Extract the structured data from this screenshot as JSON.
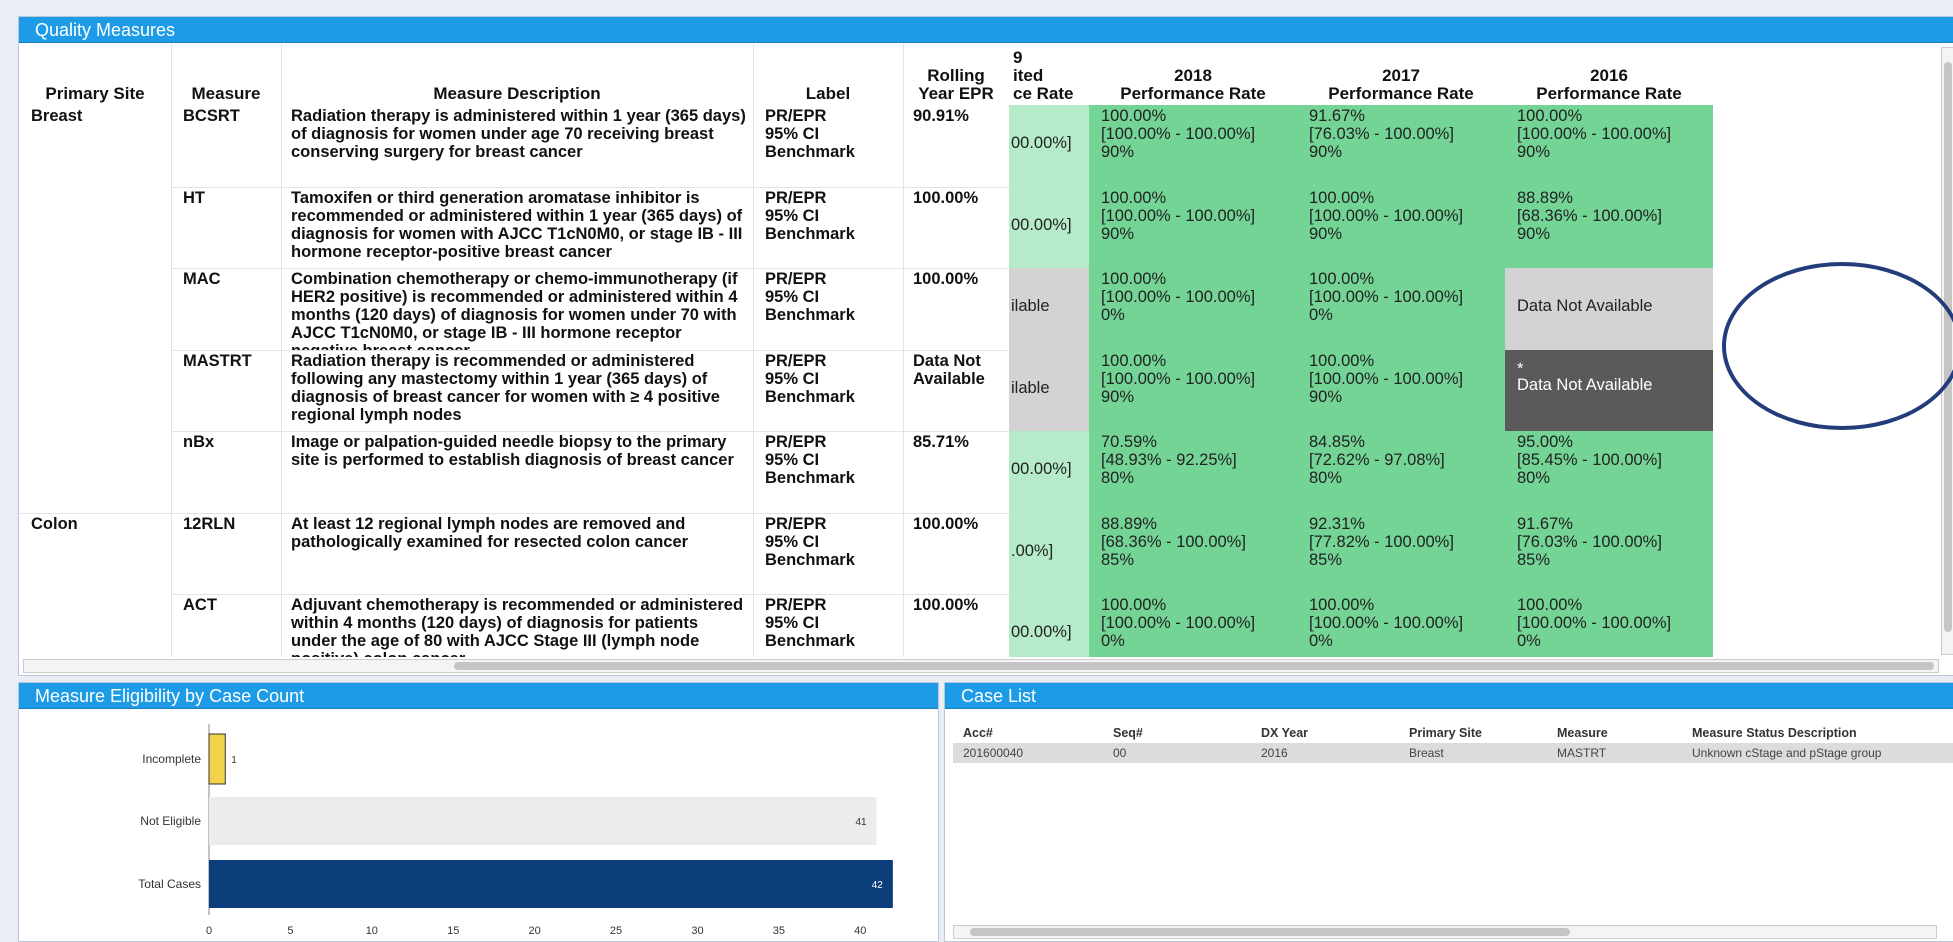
{
  "quality_measures": {
    "title": "Quality Measures",
    "headers": {
      "primary_site": "Primary Site",
      "measure": "Measure",
      "description": "Measure Description",
      "label": "Label",
      "rolling_l1": "Rolling",
      "rolling_l2": "Year EPR",
      "cut_l0": "9",
      "cut_l1": "ited",
      "cut_l2": "ce Rate",
      "y2018_l1": "2018",
      "y2018_l2": "Performance Rate",
      "y2017_l1": "2017",
      "y2017_l2": "Performance Rate",
      "y2016_l1": "2016",
      "y2016_l2": "Performance Rate"
    },
    "rows": [
      {
        "site": "Breast",
        "measure": "BCSRT",
        "desc": "Radiation therapy is administered within 1 year (365 days) of diagnosis for women under age 70 receiving breast conserving surgery for breast cancer",
        "label1": "PR/EPR",
        "label2": "95% CI",
        "label3": "Benchmark",
        "rolling": "90.91%",
        "cut": "00.00%]",
        "y2018": [
          "100.00%",
          "[100.00% - 100.00%]",
          "90%"
        ],
        "y2017": [
          "91.67%",
          "[76.03% - 100.00%]",
          "90%"
        ],
        "y2016": [
          "100.00%",
          "[100.00% - 100.00%]",
          "90%"
        ]
      },
      {
        "site": "",
        "measure": "HT",
        "desc": "Tamoxifen or third generation aromatase inhibitor is recommended or administered within 1 year (365 days) of diagnosis for women with AJCC T1cN0M0, or stage IB - III hormone receptor-positive breast cancer",
        "label1": "PR/EPR",
        "label2": "95% CI",
        "label3": "Benchmark",
        "rolling": "100.00%",
        "cut": "00.00%]",
        "y2018": [
          "100.00%",
          "[100.00% - 100.00%]",
          "90%"
        ],
        "y2017": [
          "100.00%",
          "[100.00% - 100.00%]",
          "90%"
        ],
        "y2016": [
          "88.89%",
          "[68.36% - 100.00%]",
          "90%"
        ]
      },
      {
        "site": "",
        "measure": "MAC",
        "desc": "Combination chemotherapy or chemo-immunotherapy (if HER2 positive) is recommended or administered within 4 months (120 days) of diagnosis for women under 70 with AJCC T1cN0M0, or stage IB - III hormone receptor negative breast cancer",
        "label1": "PR/EPR",
        "label2": "95% CI",
        "label3": "Benchmark",
        "rolling": "100.00%",
        "cut": "ilable",
        "y2018": [
          "100.00%",
          "[100.00% - 100.00%]",
          "0%"
        ],
        "y2017": [
          "100.00%",
          "[100.00% - 100.00%]",
          "0%"
        ],
        "y2016_na": "Data Not Available"
      },
      {
        "site": "",
        "measure": "MASTRT",
        "desc": "Radiation therapy is recommended or administered following any mastectomy within 1 year (365 days) of diagnosis of breast cancer for women with ≥ 4 positive regional lymph nodes",
        "label1": "PR/EPR",
        "label2": "95% CI",
        "label3": "Benchmark",
        "rolling": "Data Not Available",
        "cut": "ilable",
        "y2018": [
          "100.00%",
          "[100.00% - 100.00%]",
          "90%"
        ],
        "y2017": [
          "100.00%",
          "[100.00% - 100.00%]",
          "90%"
        ],
        "y2016_star": "*",
        "y2016_na": "Data Not Available"
      },
      {
        "site": "",
        "measure": "nBx",
        "desc": "Image or palpation-guided needle biopsy to the primary site is performed to establish diagnosis of breast cancer",
        "label1": "PR/EPR",
        "label2": "95% CI",
        "label3": "Benchmark",
        "rolling": "85.71%",
        "cut": "00.00%]",
        "y2018": [
          "70.59%",
          "[48.93% - 92.25%]",
          "80%"
        ],
        "y2017": [
          "84.85%",
          "[72.62% - 97.08%]",
          "80%"
        ],
        "y2016": [
          "95.00%",
          "[85.45% - 100.00%]",
          "80%"
        ]
      },
      {
        "site": "Colon",
        "measure": "12RLN",
        "desc": "At least 12 regional lymph nodes are removed and pathologically examined for resected colon cancer",
        "label1": "PR/EPR",
        "label2": "95% CI",
        "label3": "Benchmark",
        "rolling": "100.00%",
        "cut": ".00%]",
        "y2018": [
          "88.89%",
          "[68.36% - 100.00%]",
          "85%"
        ],
        "y2017": [
          "92.31%",
          "[77.82% - 100.00%]",
          "85%"
        ],
        "y2016": [
          "91.67%",
          "[76.03% - 100.00%]",
          "85%"
        ]
      },
      {
        "site": "",
        "measure": "ACT",
        "desc": "Adjuvant chemotherapy is recommended or administered within 4 months (120 days) of diagnosis for patients under the age of 80 with AJCC Stage III (lymph node positive) colon cancer",
        "label1": "PR/EPR",
        "label2": "95% CI",
        "label3": "Benchmark",
        "rolling": "100.00%",
        "cut": "00.00%]",
        "y2018": [
          "100.00%",
          "[100.00% - 100.00%]",
          "0%"
        ],
        "y2017": [
          "100.00%",
          "[100.00% - 100.00%]",
          "0%"
        ],
        "y2016": [
          "100.00%",
          "[100.00% - 100.00%]",
          "0%"
        ]
      }
    ],
    "colors": {
      "green": "#73d495",
      "light_green": "#b6ebc9",
      "grey": "#d3d3d3",
      "dark_grey": "#5a5a5a",
      "header": "#1e9be6"
    }
  },
  "eligibility": {
    "title": "Measure Eligibility by Case Count",
    "chart_data": {
      "type": "bar",
      "orientation": "horizontal",
      "categories": [
        "Incomplete",
        "Not Eligible",
        "Total Cases"
      ],
      "values": [
        1,
        41,
        42
      ],
      "colors": [
        "#f2d24a",
        "#ececec",
        "#0d3e7c"
      ],
      "xlim": [
        0,
        42
      ],
      "xticks": [
        0,
        5,
        10,
        15,
        20,
        25,
        30,
        35,
        40
      ]
    }
  },
  "case_list": {
    "title": "Case List",
    "columns": [
      "Acc#",
      "Seq#",
      "DX Year",
      "Primary Site",
      "Measure",
      "Measure Status Description"
    ],
    "rows": [
      [
        "201600040",
        "00",
        "2016",
        "Breast",
        "MASTRT",
        "Unknown cStage and  pStage group"
      ]
    ]
  }
}
